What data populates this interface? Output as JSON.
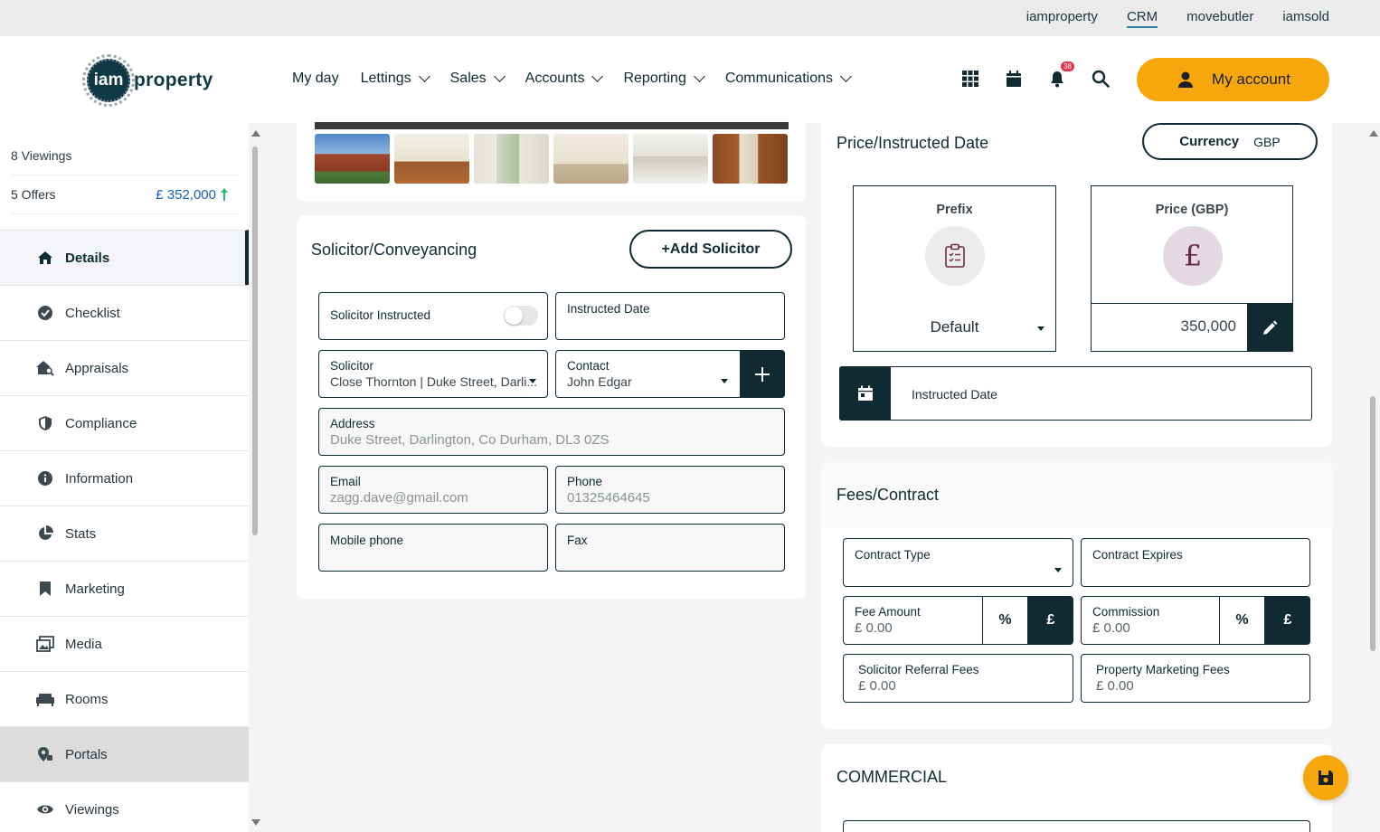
{
  "top_links": [
    "iamproperty",
    "CRM",
    "movebutler",
    "iamsold"
  ],
  "logo": {
    "mark": "iam",
    "word": "property"
  },
  "nav": [
    {
      "label": "My day",
      "dropdown": false
    },
    {
      "label": "Lettings",
      "dropdown": true
    },
    {
      "label": "Sales",
      "dropdown": true
    },
    {
      "label": "Accounts",
      "dropdown": true
    },
    {
      "label": "Reporting",
      "dropdown": true
    },
    {
      "label": "Communications",
      "dropdown": true
    }
  ],
  "header": {
    "notifications_count": "38",
    "account_label": "My account",
    "accent_color": "#f7a70b"
  },
  "sidebar": {
    "viewings": "8 Viewings",
    "offers": "5 Offers",
    "offer_price": "£ 352,000",
    "items": [
      {
        "label": "Details",
        "icon": "home-icon"
      },
      {
        "label": "Checklist",
        "icon": "check-circle-icon"
      },
      {
        "label": "Appraisals",
        "icon": "house-search-icon"
      },
      {
        "label": "Compliance",
        "icon": "shield-icon"
      },
      {
        "label": "Information",
        "icon": "info-icon"
      },
      {
        "label": "Stats",
        "icon": "pie-chart-icon"
      },
      {
        "label": "Marketing",
        "icon": "bookmark-icon"
      },
      {
        "label": "Media",
        "icon": "images-icon"
      },
      {
        "label": "Rooms",
        "icon": "sofa-icon"
      },
      {
        "label": "Portals",
        "icon": "map-pin-icon"
      },
      {
        "label": "Viewings",
        "icon": "eye-icon"
      }
    ]
  },
  "solicitor": {
    "title": "Solicitor/Conveyancing",
    "add_button": "+Add Solicitor",
    "instructed_label": "Solicitor Instructed",
    "instructed_date_label": "Instructed Date",
    "solicitor_label": "Solicitor",
    "solicitor_value": "Close Thornton | Duke Street, Darli...",
    "contact_label": "Contact",
    "contact_value": "John Edgar",
    "address_label": "Address",
    "address_value": "Duke Street, Darlington, Co Durham, DL3 0ZS",
    "email_label": "Email",
    "email_value": "zagg.dave@gmail.com",
    "phone_label": "Phone",
    "phone_value": "01325464645",
    "mobile_label": "Mobile phone",
    "fax_label": "Fax"
  },
  "price": {
    "title": "Price/Instructed Date",
    "currency_label": "Currency",
    "currency_value": "GBP",
    "prefix_label": "Prefix",
    "prefix_value": "Default",
    "price_label": "Price (GBP)",
    "price_value": "350,000",
    "instructed_date_label": "Instructed Date"
  },
  "fees": {
    "title": "Fees/Contract",
    "contract_type_label": "Contract Type",
    "contract_expires_label": "Contract Expires",
    "fee_amount_label": "Fee Amount",
    "fee_amount_value": "£ 0.00",
    "commission_label": "Commission",
    "commission_value": "£ 0.00",
    "percent_symbol": "%",
    "pound_symbol": "£",
    "solicitor_referral_label": "Solicitor Referral Fees",
    "solicitor_referral_value": "£ 0.00",
    "marketing_fees_label": "Property Marketing Fees",
    "marketing_fees_value": "£ 0.00"
  },
  "commercial": {
    "title": "COMMERCIAL"
  }
}
